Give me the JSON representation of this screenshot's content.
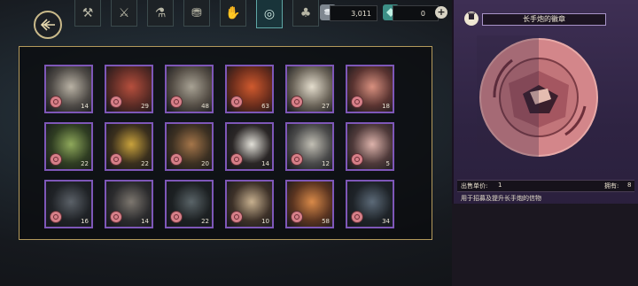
{
  "header": {
    "currency_a": {
      "icon": "coin-stack-icon",
      "value": "3,011"
    },
    "currency_b": {
      "icon": "gem-icon",
      "value": "0"
    },
    "tabs": [
      {
        "icon": "boot-icon",
        "active": false
      },
      {
        "icon": "sword-icon",
        "active": false
      },
      {
        "icon": "potion-icon",
        "active": false
      },
      {
        "icon": "bag-icon",
        "active": false
      },
      {
        "icon": "hand-icon",
        "active": false
      },
      {
        "icon": "medal-icon",
        "active": true
      },
      {
        "icon": "clover-icon",
        "active": false
      }
    ]
  },
  "grid": {
    "items": [
      {
        "name": "armored-rodent",
        "count": "14",
        "colors": [
          "#4e4a46",
          "#b9b2a4"
        ]
      },
      {
        "name": "red-beast",
        "count": "29",
        "colors": [
          "#5a2b25",
          "#b64f3d"
        ]
      },
      {
        "name": "grey-monkey",
        "count": "48",
        "colors": [
          "#544d45",
          "#a8a294"
        ]
      },
      {
        "name": "red-fox",
        "count": "63",
        "colors": [
          "#6b2d1c",
          "#d05a2e"
        ]
      },
      {
        "name": "white-hooded",
        "count": "27",
        "colors": [
          "#6a6358",
          "#e4ddcd"
        ]
      },
      {
        "name": "pink-mouse",
        "count": "18",
        "colors": [
          "#5a3431",
          "#d8907f"
        ]
      },
      {
        "name": "green-lizard",
        "count": "22",
        "colors": [
          "#2f3d22",
          "#8fa95b"
        ]
      },
      {
        "name": "crested-bird",
        "count": "22",
        "colors": [
          "#3a2f1d",
          "#c9a23c"
        ]
      },
      {
        "name": "helmet-rat",
        "count": "20",
        "colors": [
          "#3c3022",
          "#a5764a"
        ]
      },
      {
        "name": "panda-warrior",
        "count": "14",
        "colors": [
          "#2a2626",
          "#e2e0d8"
        ]
      },
      {
        "name": "knight-mouse",
        "count": "12",
        "colors": [
          "#4a4a4a",
          "#c2bfb4"
        ]
      },
      {
        "name": "bunny",
        "count": "5",
        "colors": [
          "#4f3a3a",
          "#ddb3ab"
        ]
      },
      {
        "name": "dark-wolf",
        "count": "16",
        "colors": [
          "#1f2226",
          "#5b6168"
        ]
      },
      {
        "name": "grey-boar",
        "count": "14",
        "colors": [
          "#2b2b2d",
          "#7d776f"
        ]
      },
      {
        "name": "black-rat",
        "count": "22",
        "colors": [
          "#1c2022",
          "#5a6468"
        ]
      },
      {
        "name": "goggle-raccoon",
        "count": "10",
        "colors": [
          "#3d3128",
          "#c7b08f"
        ]
      },
      {
        "name": "shiba-dog",
        "count": "58",
        "colors": [
          "#5a3420",
          "#d98a49"
        ]
      },
      {
        "name": "horned-beetle",
        "count": "34",
        "colors": [
          "#1e2328",
          "#5c6a78"
        ]
      }
    ]
  },
  "detail": {
    "title": "长手炮的徽章",
    "sell_label": "出售单价:",
    "sell_value": "1",
    "own_label": "拥有:",
    "own_value": "8",
    "description": "用于招募及提升长手炮的信物",
    "colors": {
      "medal": "#d98c8f",
      "panel": "#3e2f54"
    }
  }
}
